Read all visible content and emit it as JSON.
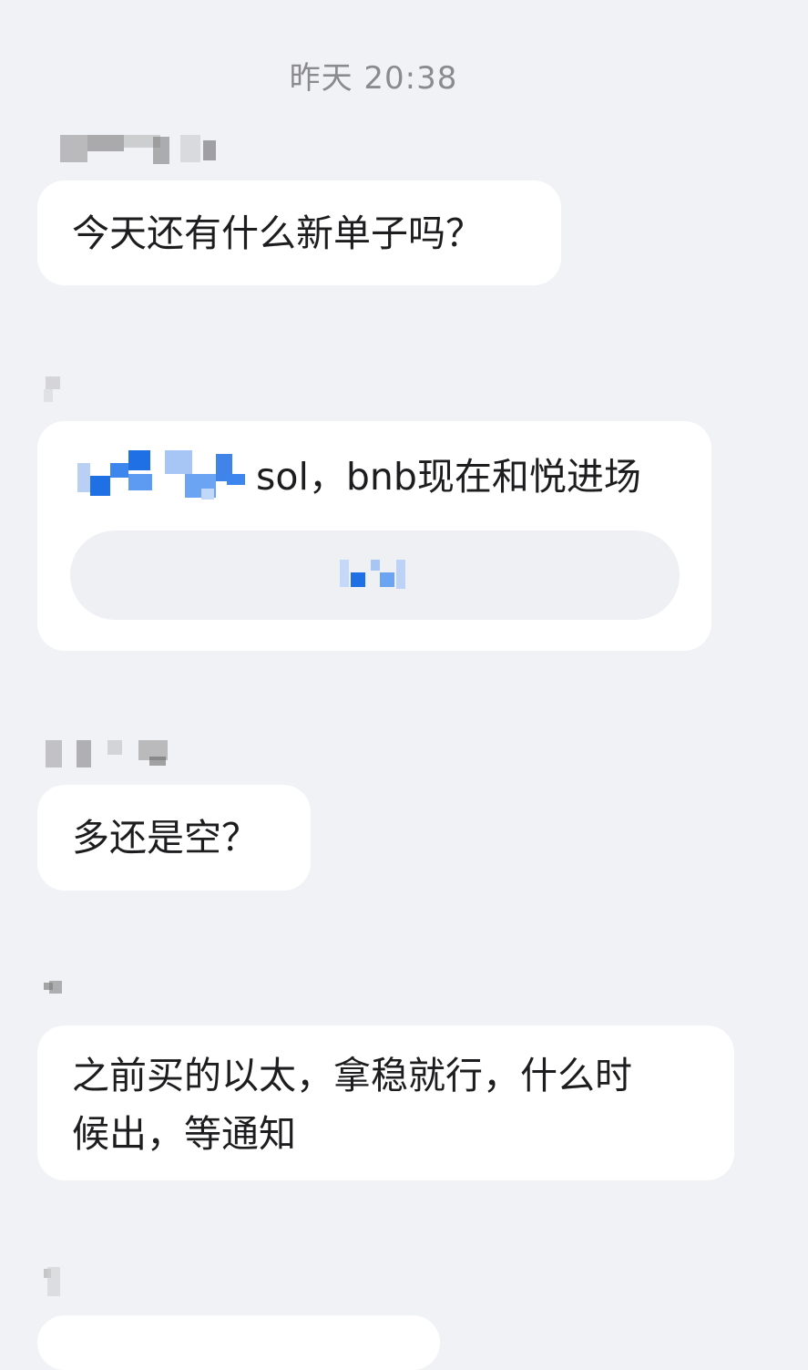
{
  "timestamp": "昨天 20:38",
  "messages": [
    {
      "text": "今天还有什么新单子吗？"
    },
    {
      "text": "sol，bnb现在和悦进场"
    },
    {
      "text": "多还是空？"
    },
    {
      "line1": "之前买的以太，拿稳就行，什么时",
      "line2": "候出，等通知"
    }
  ],
  "colors": {
    "background": "#f1f2f5",
    "bubble": "#ffffff",
    "accent_blue": "#1f6fe5",
    "muted_text": "#8a8a8f"
  }
}
